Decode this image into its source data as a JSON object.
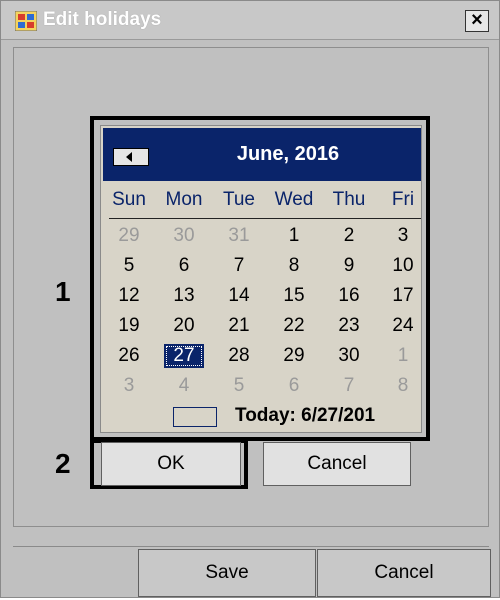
{
  "window": {
    "title": "Edit holidays",
    "close_label": "×"
  },
  "annotations": {
    "label_1": "1",
    "label_2": "2"
  },
  "calendar": {
    "month_label": "June, 2016",
    "day_headers": [
      "Sun",
      "Mon",
      "Tue",
      "Wed",
      "Thu",
      "Fri"
    ],
    "weeks": [
      [
        "29",
        "30",
        "31",
        "1",
        "2",
        "3"
      ],
      [
        "5",
        "6",
        "7",
        "8",
        "9",
        "10"
      ],
      [
        "12",
        "13",
        "14",
        "15",
        "16",
        "17"
      ],
      [
        "19",
        "20",
        "21",
        "22",
        "23",
        "24"
      ],
      [
        "26",
        "27",
        "28",
        "29",
        "30",
        "1"
      ],
      [
        "3",
        "4",
        "5",
        "6",
        "7",
        "8"
      ]
    ],
    "selected_day": "27",
    "today_text": "Today: 6/27/201"
  },
  "buttons": {
    "ok": "OK",
    "cancel": "Cancel",
    "save": "Save",
    "footer_cancel": "Cancel"
  },
  "colors": {
    "header": "#0a246a",
    "window_bg": "#c0c0c0",
    "calendar_bg": "#d8d4c8"
  }
}
